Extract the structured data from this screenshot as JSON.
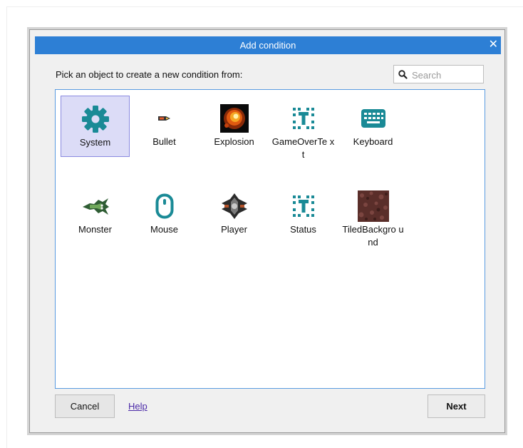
{
  "dialog": {
    "title": "Add condition",
    "close_glyph": "✕",
    "prompt": "Pick an object to create a new condition from:",
    "search": {
      "placeholder": "Search",
      "value": "",
      "icon": "search-icon"
    },
    "objects": [
      {
        "label": "System",
        "icon": "gear-icon",
        "selected": true
      },
      {
        "label": "Bullet",
        "icon": "bullet-sprite-icon",
        "selected": false
      },
      {
        "label": "Explosion",
        "icon": "explosion-sprite-icon",
        "selected": false
      },
      {
        "label": "GameOverTe xt",
        "icon": "text-object-icon",
        "selected": false
      },
      {
        "label": "Keyboard",
        "icon": "keyboard-icon",
        "selected": false
      },
      {
        "label": "Monster",
        "icon": "monster-sprite-icon",
        "selected": false
      },
      {
        "label": "Mouse",
        "icon": "mouse-icon",
        "selected": false
      },
      {
        "label": "Player",
        "icon": "player-sprite-icon",
        "selected": false
      },
      {
        "label": "Status",
        "icon": "text-object-icon",
        "selected": false
      },
      {
        "label": "TiledBackgro und",
        "icon": "tiled-background-icon",
        "selected": false
      }
    ],
    "buttons": {
      "cancel": "Cancel",
      "help": "Help",
      "next": "Next"
    },
    "colors": {
      "titlebar": "#2d7fd5",
      "accent": "#1a8a96",
      "selection": "#dcdcf7",
      "link": "#4b2aa8"
    }
  }
}
